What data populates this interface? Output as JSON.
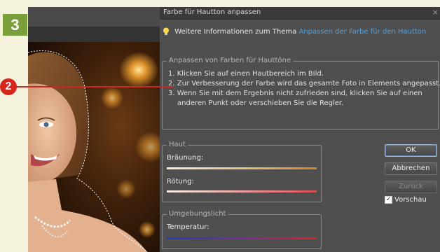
{
  "step_number": "3",
  "callout_number": "2",
  "dialog": {
    "title": "Farbe für Hautton anpassen",
    "close_glyph": "×",
    "info_prefix": "Weitere Informationen zum Thema",
    "info_link": "Anpassen der Farbe für den Hautton",
    "instructions_legend": "Anpassen von Farben für Hauttöne",
    "instructions": [
      "1. Klicken Sie auf einen Hautbereich im Bild.",
      "2. Zur Verbesserung der Farbe wird das gesamte Foto in Elements angepasst.",
      "3. Wenn Sie mit dem Ergebnis nicht zufrieden sind, klicken Sie auf einen",
      "anderen Punkt oder verschieben Sie die Regler."
    ],
    "haut": {
      "legend": "Haut",
      "braeunung_label": "Bräunung:",
      "braeunung_gradient": [
        "#f6efe0",
        "#e6c48a",
        "#c9852d"
      ],
      "roetung_label": "Rötung:",
      "roetung_gradient": [
        "#f6ece6",
        "#eea3a0",
        "#d9484e"
      ]
    },
    "umgebungslicht": {
      "legend": "Umgebungslicht",
      "temperatur_label": "Temperatur:",
      "temperatur_gradient": [
        "#1f3fb8",
        "#7b2aa0",
        "#e01f1f"
      ]
    },
    "buttons": {
      "ok": "OK",
      "cancel": "Abbrechen",
      "reset": "Zurück"
    },
    "preview_label": "Vorschau",
    "preview_checked": true
  },
  "colors": {
    "step_badge": "#7a9e3a",
    "callout": "#d7261e",
    "link": "#4aa3e8",
    "dialog_bg": "#4f4f4f"
  }
}
